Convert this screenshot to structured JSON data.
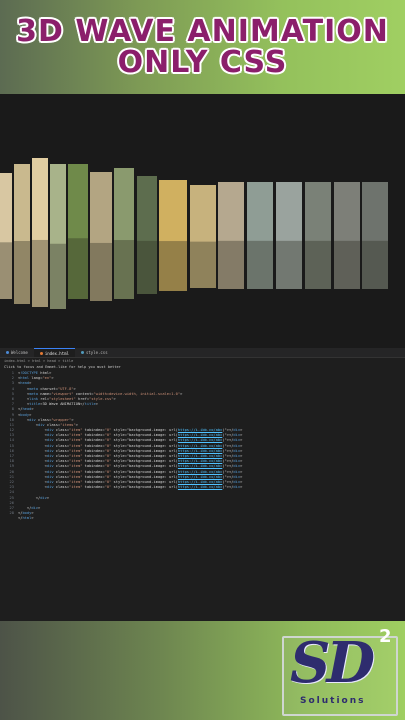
{
  "banner": {
    "line1": "3D WAVE ANIMATION",
    "line2": "ONLY CSS"
  },
  "editor": {
    "tabs": [
      {
        "label": "Welcome",
        "icon": "welcome-icon",
        "active": false
      },
      {
        "label": "index.html",
        "icon": "html-file-icon",
        "active": true
      },
      {
        "label": "style.css",
        "icon": "css-file-icon",
        "active": false
      }
    ],
    "breadcrumb": "index.html > html > head > title",
    "hint": "Click to focus and Emmet-like for help you must better",
    "line_numbers": [
      "1",
      "2",
      "3",
      "4",
      "5",
      "6",
      "7",
      "8",
      "9",
      "10",
      "11",
      "12",
      "13",
      "14",
      "15",
      "16",
      "17",
      "18",
      "19",
      "20",
      "21",
      "22",
      "23",
      "24",
      "25",
      "26",
      "27",
      "28"
    ],
    "item_tag_open": "<div class=\"item\" tabindex=\"0\" style=\"background-image: url(",
    "item_tag_close": ")\"></div>",
    "item_urls": [
      "https://i.ibb.co/abc",
      "https://i.ibb.co/abc",
      "https://i.ibb.co/abc",
      "https://i.ibb.co/abc",
      "https://i.ibb.co/abc",
      "https://i.ibb.co/abc",
      "https://i.ibb.co/abc",
      "https://i.ibb.co/abc",
      "https://i.ibb.co/abc",
      "https://i.ibb.co/abc",
      "https://i.ibb.co/abc",
      "https://i.ibb.co/abc"
    ],
    "lines_head": [
      "<!DOCTYPE html>",
      "<html lang=\"en\">",
      "<head>",
      "    <meta charset=\"UTF-8\">",
      "    <meta name=\"viewport\" content=\"width=device-width, initial-scale=1.0\">",
      "    <link rel=\"stylesheet\" href=\"style.css\">",
      "    <title>3D Wave ANIMATION</title>",
      "</head>",
      "<body>",
      "    <div class=\"wrapper\">",
      "        <div class=\"items\">"
    ],
    "lines_tail": [
      "",
      "        </div>",
      "",
      "    </div>",
      "</body>",
      "</html>"
    ]
  },
  "logo": {
    "mark": "SD",
    "superscript": "2",
    "word": "Solutions"
  },
  "colors": {
    "title": "#8b1f6b",
    "logo_navy": "#2e2c6e",
    "accent_green": "#94c15c"
  }
}
